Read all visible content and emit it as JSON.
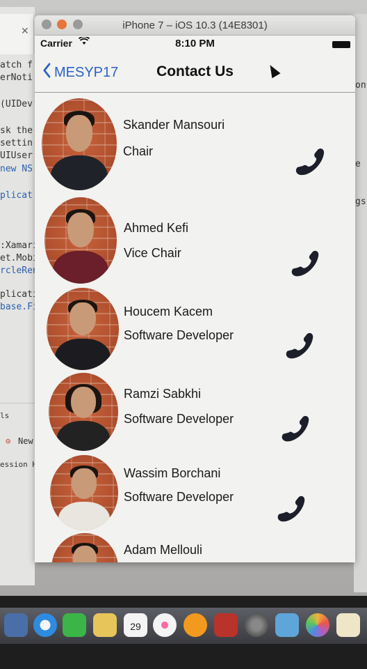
{
  "ide": {
    "code_lines": [
      "atch f",
      "erNoti",
      "(UIDev",
      "sk the",
      "settin",
      "UIUser",
      " new NS",
      "plicat",
      ":Xamari",
      "et.Mobi",
      "rcleRen",
      "plicatio",
      " base.Fi"
    ],
    "panel_items": [
      "ls",
      "New F",
      "ession  Hit"
    ],
    "right_code": [
      "on",
      "e",
      "gs("
    ]
  },
  "simulator": {
    "window_title": "iPhone 7 – iOS 10.3 (14E8301)",
    "status": {
      "carrier": "Carrier",
      "time": "8:10 PM"
    },
    "nav": {
      "back_label": "MESYP17",
      "title": "Contact Us"
    },
    "contacts": [
      {
        "name": "Skander Mansouri",
        "role": "Chair"
      },
      {
        "name": "Ahmed Kefi",
        "role": "Vice Chair"
      },
      {
        "name": "Houcem Kacem",
        "role": "Software Developer"
      },
      {
        "name": "Ramzi Sabkhi",
        "role": "Software Developer"
      },
      {
        "name": "Wassim Borchani",
        "role": "Software Developer"
      },
      {
        "name": "Adam Mellouli",
        "role": ""
      }
    ]
  },
  "dock": {
    "calendar_day": "29",
    "icons": [
      "app-icon",
      "safari-icon",
      "facetime-icon",
      "notes-icon",
      "calendar-icon",
      "itunes-icon",
      "ibooks-icon",
      "photo-booth-icon",
      "system-preferences-icon",
      "preview-icon",
      "photos-icon",
      "textedit-icon"
    ]
  }
}
